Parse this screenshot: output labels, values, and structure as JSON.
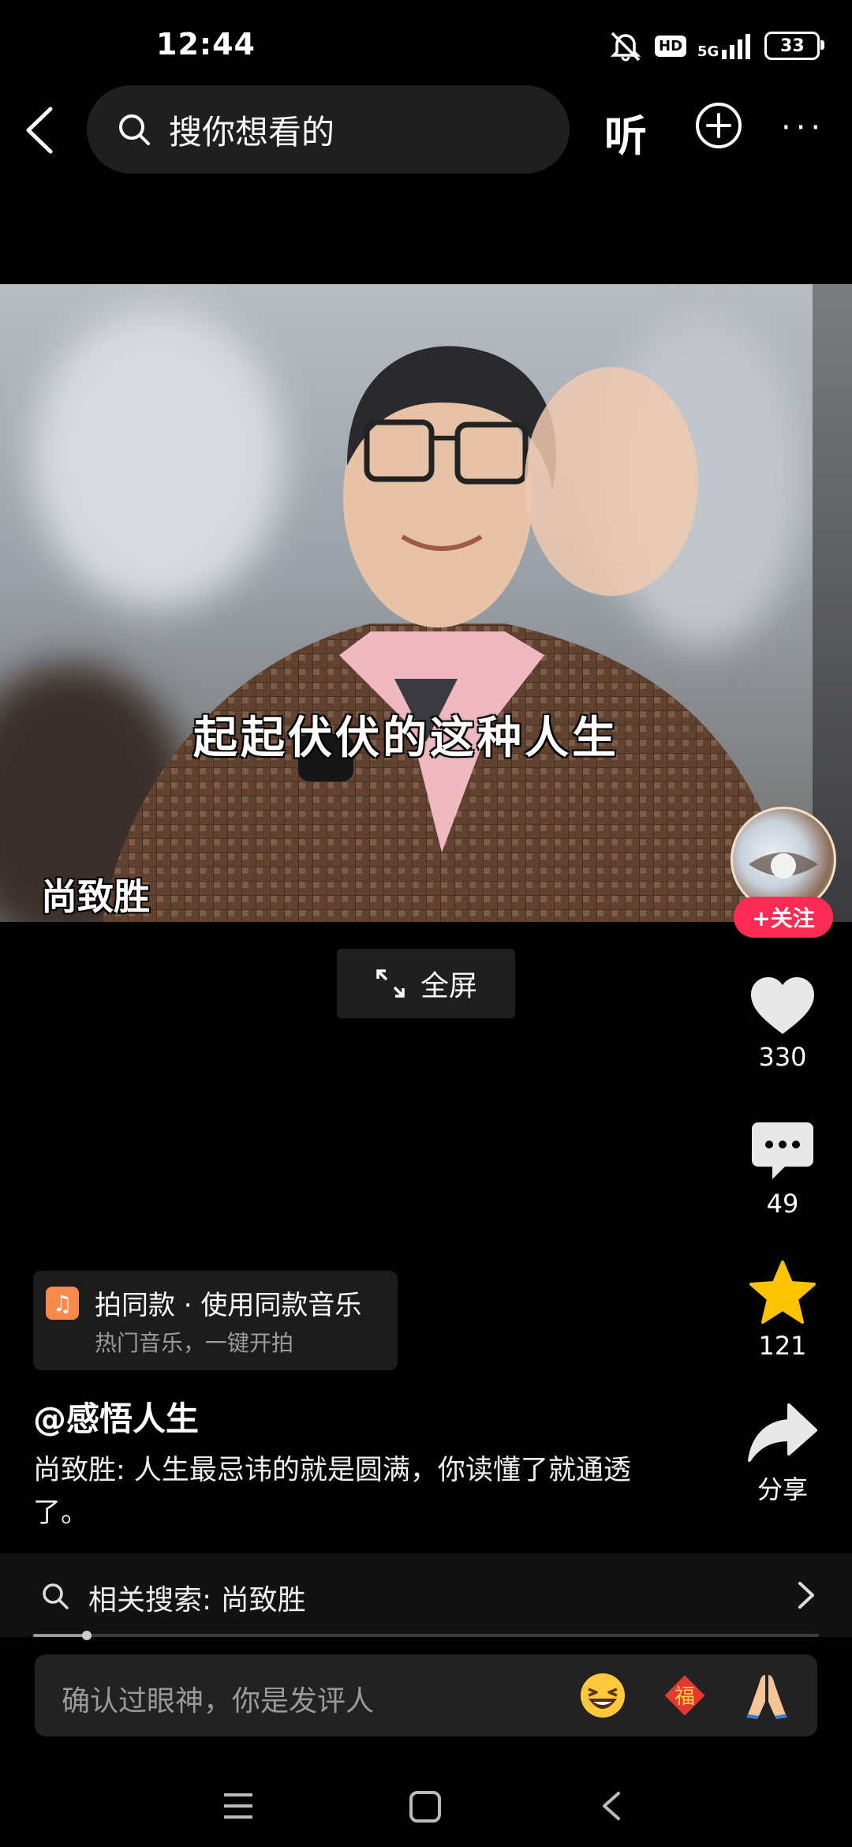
{
  "status_bar": {
    "time": "12:44",
    "hd_badge": "HD",
    "network": "5G",
    "battery": "33"
  },
  "top_nav": {
    "search_placeholder": "搜你想看的",
    "listen_label": "听",
    "more_label": "···"
  },
  "video": {
    "caption": "起起伏伏的这种人生",
    "name_overlay": "尚致胜",
    "fullscreen_label": "全屏"
  },
  "creator": {
    "follow_label": "+关注"
  },
  "actions": {
    "like_count": "330",
    "comment_count": "49",
    "favorite_count": "121",
    "share_label": "分享"
  },
  "music": {
    "title": "拍同款 · 使用同款音乐",
    "subtitle": "热门音乐，一键开拍"
  },
  "post": {
    "author": "@感悟人生",
    "description": "尚致胜: 人生最忌讳的就是圆满，你读懂了就通透了。"
  },
  "related_search": {
    "label": "相关搜索: 尚致胜"
  },
  "playback": {
    "progress": 0.068
  },
  "comment_bar": {
    "placeholder": "确认过眼神，你是发评人"
  },
  "colors": {
    "follow_red": "#fe2c55",
    "favorite_yellow": "#ffc300",
    "music_orange": "#f7894b"
  },
  "icons": [
    "back-arrow-icon",
    "search-icon",
    "add-circle-icon",
    "more-icon",
    "expand-icon",
    "heart-icon",
    "comment-icon",
    "star-icon",
    "share-icon",
    "music-note-icon",
    "chevron-right-icon",
    "laugh-emoji-icon",
    "fu-emoji-icon",
    "pray-emoji-icon"
  ]
}
